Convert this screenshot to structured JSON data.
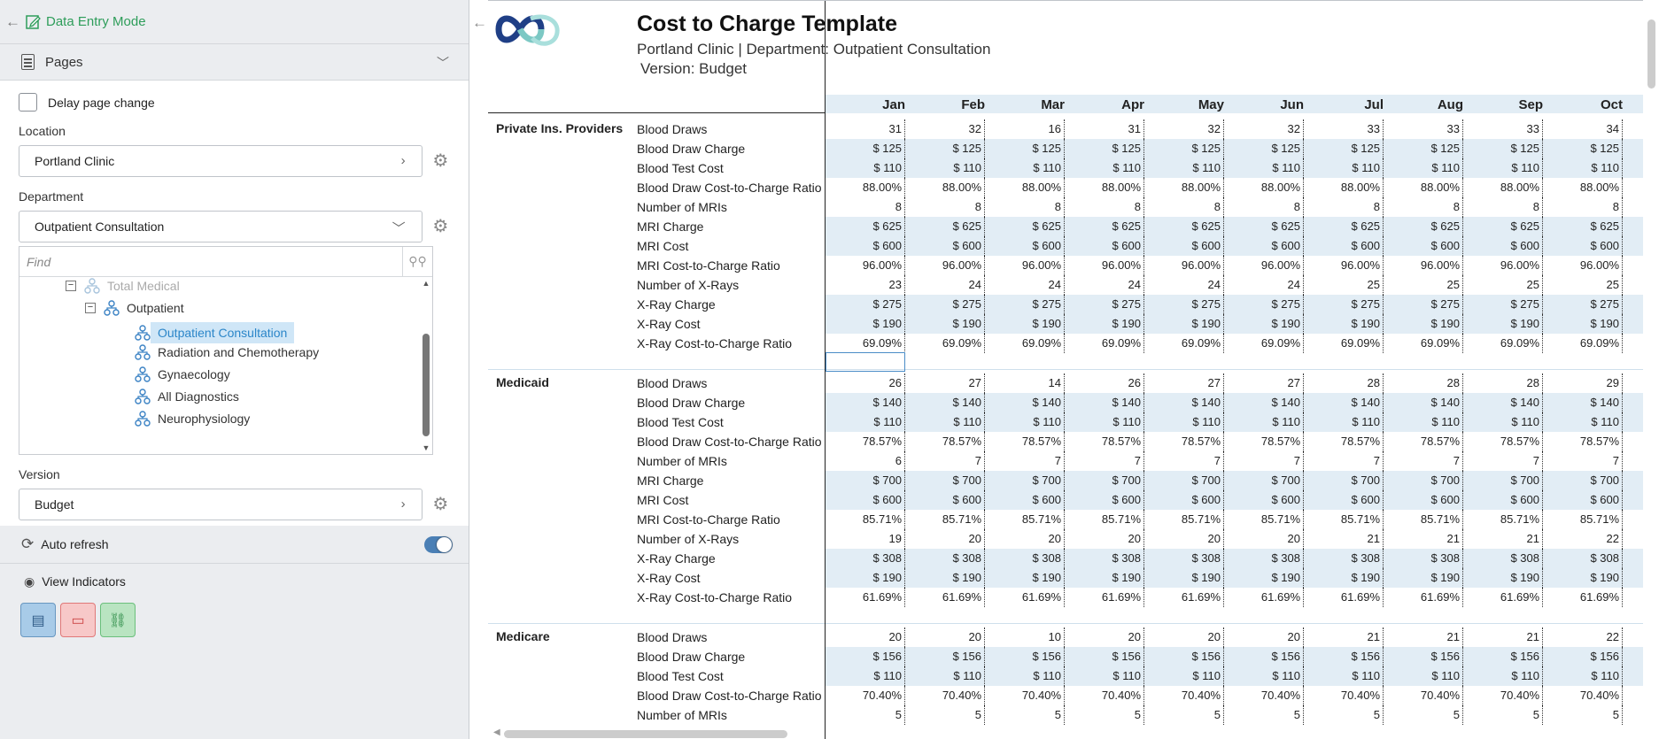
{
  "header": {
    "mode_label": "Data Entry Mode",
    "pages_label": "Pages"
  },
  "form": {
    "delay_label": "Delay page change",
    "location_label": "Location",
    "location_value": "Portland Clinic",
    "department_label": "Department",
    "department_value": "Outpatient Consultation",
    "find_placeholder": "Find",
    "tree": [
      "Total Medical",
      "Outpatient",
      "Outpatient Consultation",
      "Radiation and Chemotherapy",
      "Gynaecology",
      "All Diagnostics",
      "Neurophysiology"
    ],
    "version_label": "Version",
    "version_value": "Budget",
    "auto_refresh_label": "Auto refresh",
    "auto_refresh_on": true,
    "view_indicators_label": "View Indicators"
  },
  "report": {
    "title": "Cost to Charge Template",
    "subtitle": "Portland Clinic | Department: Outpatient Consultation",
    "version_line": "Version: Budget",
    "months": [
      "Jan",
      "Feb",
      "Mar",
      "Apr",
      "May",
      "Jun",
      "Jul",
      "Aug",
      "Sep",
      "Oct"
    ],
    "colors": {
      "shade": "#e2edf5",
      "accent_green": "#2e9d5a",
      "selected_blue": "#2b86c9"
    },
    "sections": [
      {
        "name": "Private Ins. Providers",
        "rows": [
          {
            "label": "Blood Draws",
            "shaded": false,
            "values": [
              "31",
              "32",
              "16",
              "31",
              "32",
              "32",
              "33",
              "33",
              "33",
              "34"
            ]
          },
          {
            "label": "Blood Draw Charge",
            "shaded": true,
            "values": [
              "$ 125",
              "$ 125",
              "$ 125",
              "$ 125",
              "$ 125",
              "$ 125",
              "$ 125",
              "$ 125",
              "$ 125",
              "$ 125"
            ]
          },
          {
            "label": "Blood Test Cost",
            "shaded": true,
            "values": [
              "$ 110",
              "$ 110",
              "$ 110",
              "$ 110",
              "$ 110",
              "$ 110",
              "$ 110",
              "$ 110",
              "$ 110",
              "$ 110"
            ]
          },
          {
            "label": "Blood Draw Cost-to-Charge Ratio",
            "shaded": false,
            "values": [
              "88.00%",
              "88.00%",
              "88.00%",
              "88.00%",
              "88.00%",
              "88.00%",
              "88.00%",
              "88.00%",
              "88.00%",
              "88.00%"
            ]
          },
          {
            "label": "Number of MRIs",
            "shaded": false,
            "values": [
              "8",
              "8",
              "8",
              "8",
              "8",
              "8",
              "8",
              "8",
              "8",
              "8"
            ]
          },
          {
            "label": "MRI Charge",
            "shaded": true,
            "values": [
              "$ 625",
              "$ 625",
              "$ 625",
              "$ 625",
              "$ 625",
              "$ 625",
              "$ 625",
              "$ 625",
              "$ 625",
              "$ 625"
            ]
          },
          {
            "label": "MRI Cost",
            "shaded": true,
            "values": [
              "$ 600",
              "$ 600",
              "$ 600",
              "$ 600",
              "$ 600",
              "$ 600",
              "$ 600",
              "$ 600",
              "$ 600",
              "$ 600"
            ]
          },
          {
            "label": "MRI Cost-to-Charge Ratio",
            "shaded": false,
            "values": [
              "96.00%",
              "96.00%",
              "96.00%",
              "96.00%",
              "96.00%",
              "96.00%",
              "96.00%",
              "96.00%",
              "96.00%",
              "96.00%"
            ]
          },
          {
            "label": "Number of X-Rays",
            "shaded": false,
            "values": [
              "23",
              "24",
              "24",
              "24",
              "24",
              "24",
              "25",
              "25",
              "25",
              "25"
            ]
          },
          {
            "label": "X-Ray Charge",
            "shaded": true,
            "values": [
              "$ 275",
              "$ 275",
              "$ 275",
              "$ 275",
              "$ 275",
              "$ 275",
              "$ 275",
              "$ 275",
              "$ 275",
              "$ 275"
            ]
          },
          {
            "label": "X-Ray Cost",
            "shaded": true,
            "values": [
              "$ 190",
              "$ 190",
              "$ 190",
              "$ 190",
              "$ 190",
              "$ 190",
              "$ 190",
              "$ 190",
              "$ 190",
              "$ 190"
            ]
          },
          {
            "label": "X-Ray Cost-to-Charge Ratio",
            "shaded": false,
            "values": [
              "69.09%",
              "69.09%",
              "69.09%",
              "69.09%",
              "69.09%",
              "69.09%",
              "69.09%",
              "69.09%",
              "69.09%",
              "69.09%"
            ]
          }
        ]
      },
      {
        "name": "Medicaid",
        "rows": [
          {
            "label": "Blood Draws",
            "shaded": false,
            "values": [
              "26",
              "27",
              "14",
              "26",
              "27",
              "27",
              "28",
              "28",
              "28",
              "29"
            ]
          },
          {
            "label": "Blood Draw Charge",
            "shaded": true,
            "values": [
              "$ 140",
              "$ 140",
              "$ 140",
              "$ 140",
              "$ 140",
              "$ 140",
              "$ 140",
              "$ 140",
              "$ 140",
              "$ 140"
            ]
          },
          {
            "label": "Blood Test Cost",
            "shaded": true,
            "values": [
              "$ 110",
              "$ 110",
              "$ 110",
              "$ 110",
              "$ 110",
              "$ 110",
              "$ 110",
              "$ 110",
              "$ 110",
              "$ 110"
            ]
          },
          {
            "label": "Blood Draw Cost-to-Charge Ratio",
            "shaded": false,
            "values": [
              "78.57%",
              "78.57%",
              "78.57%",
              "78.57%",
              "78.57%",
              "78.57%",
              "78.57%",
              "78.57%",
              "78.57%",
              "78.57%"
            ]
          },
          {
            "label": "Number of MRIs",
            "shaded": false,
            "values": [
              "6",
              "7",
              "7",
              "7",
              "7",
              "7",
              "7",
              "7",
              "7",
              "7"
            ]
          },
          {
            "label": "MRI Charge",
            "shaded": true,
            "values": [
              "$ 700",
              "$ 700",
              "$ 700",
              "$ 700",
              "$ 700",
              "$ 700",
              "$ 700",
              "$ 700",
              "$ 700",
              "$ 700"
            ]
          },
          {
            "label": "MRI Cost",
            "shaded": true,
            "values": [
              "$ 600",
              "$ 600",
              "$ 600",
              "$ 600",
              "$ 600",
              "$ 600",
              "$ 600",
              "$ 600",
              "$ 600",
              "$ 600"
            ]
          },
          {
            "label": "MRI Cost-to-Charge Ratio",
            "shaded": false,
            "values": [
              "85.71%",
              "85.71%",
              "85.71%",
              "85.71%",
              "85.71%",
              "85.71%",
              "85.71%",
              "85.71%",
              "85.71%",
              "85.71%"
            ]
          },
          {
            "label": "Number of X-Rays",
            "shaded": false,
            "values": [
              "19",
              "20",
              "20",
              "20",
              "20",
              "20",
              "21",
              "21",
              "21",
              "22"
            ]
          },
          {
            "label": "X-Ray Charge",
            "shaded": true,
            "values": [
              "$ 308",
              "$ 308",
              "$ 308",
              "$ 308",
              "$ 308",
              "$ 308",
              "$ 308",
              "$ 308",
              "$ 308",
              "$ 308"
            ]
          },
          {
            "label": "X-Ray Cost",
            "shaded": true,
            "values": [
              "$ 190",
              "$ 190",
              "$ 190",
              "$ 190",
              "$ 190",
              "$ 190",
              "$ 190",
              "$ 190",
              "$ 190",
              "$ 190"
            ]
          },
          {
            "label": "X-Ray Cost-to-Charge Ratio",
            "shaded": false,
            "values": [
              "61.69%",
              "61.69%",
              "61.69%",
              "61.69%",
              "61.69%",
              "61.69%",
              "61.69%",
              "61.69%",
              "61.69%",
              "61.69%"
            ]
          }
        ]
      },
      {
        "name": "Medicare",
        "rows": [
          {
            "label": "Blood Draws",
            "shaded": false,
            "values": [
              "20",
              "20",
              "10",
              "20",
              "20",
              "20",
              "21",
              "21",
              "21",
              "22"
            ]
          },
          {
            "label": "Blood Draw Charge",
            "shaded": true,
            "values": [
              "$ 156",
              "$ 156",
              "$ 156",
              "$ 156",
              "$ 156",
              "$ 156",
              "$ 156",
              "$ 156",
              "$ 156",
              "$ 156"
            ]
          },
          {
            "label": "Blood Test Cost",
            "shaded": true,
            "values": [
              "$ 110",
              "$ 110",
              "$ 110",
              "$ 110",
              "$ 110",
              "$ 110",
              "$ 110",
              "$ 110",
              "$ 110",
              "$ 110"
            ]
          },
          {
            "label": "Blood Draw Cost-to-Charge Ratio",
            "shaded": false,
            "values": [
              "70.40%",
              "70.40%",
              "70.40%",
              "70.40%",
              "70.40%",
              "70.40%",
              "70.40%",
              "70.40%",
              "70.40%",
              "70.40%"
            ]
          },
          {
            "label": "Number of MRIs",
            "shaded": false,
            "values": [
              "5",
              "5",
              "5",
              "5",
              "5",
              "5",
              "5",
              "5",
              "5",
              "5"
            ]
          }
        ]
      }
    ]
  }
}
